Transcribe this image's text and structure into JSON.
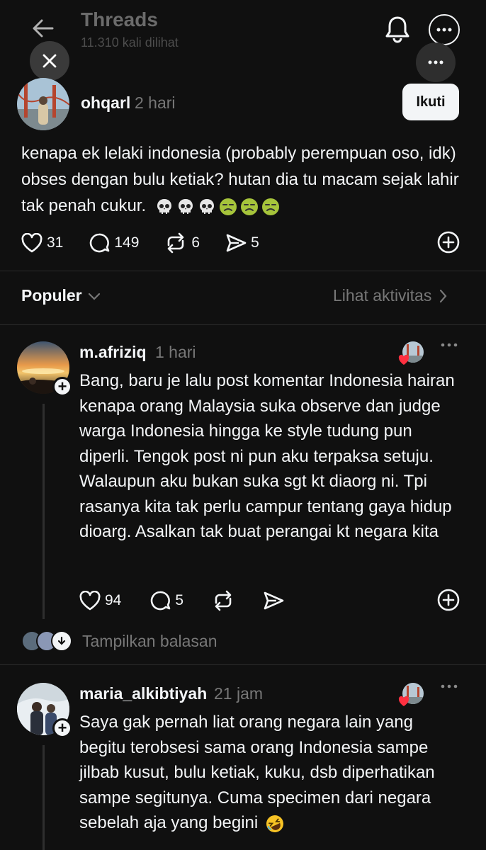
{
  "header": {
    "title": "Threads",
    "views": "11.310 kali dilihat"
  },
  "post": {
    "author": "ohqarl",
    "time": "2 hari",
    "follow_label": "Ikuti",
    "text": "kenapa ek lelaki indonesia (probably perempuan oso, idk) obses dengan bulu ketiak? hutan dia tu macam sejak lahir  tak penah cukur.",
    "emojis": [
      "skull",
      "skull",
      "skull",
      "nauseated-face",
      "nauseated-face",
      "nauseated-face"
    ],
    "likes": "31",
    "comments": "149",
    "reposts": "6",
    "shares": "5"
  },
  "sort": {
    "label": "Populer",
    "activity_label": "Lihat aktivitas"
  },
  "replies": [
    {
      "author": "m.afriziq",
      "time": "1 hari",
      "text": "Bang, baru je lalu post komentar Indonesia hairan kenapa orang Malaysia suka observe dan judge warga Indonesia hingga ke style tudung pun diperli. Tengok post ni pun aku terpaksa setuju. Walaupun aku bukan suka sgt kt diaorg ni. Tpi rasanya kita tak perlu campur tentang gaya hidup dioarg. Asalkan tak buat perangai kt negara kita",
      "likes": "94",
      "comments": "5",
      "show_replies_label": "Tampilkan balasan"
    },
    {
      "author": "maria_alkibtiyah",
      "time": "21 jam",
      "text": "Saya gak pernah liat orang negara lain yang begitu terobsesi sama orang Indonesia sampe jilbab kusut, bulu ketiak, kuku, dsb diperhatikan sampe segitunya. Cuma specimen dari negara sebelah aja yang begini",
      "emoji": "rolling-on-floor-laughing"
    }
  ],
  "colors": {
    "background": "#101010",
    "text": "#f3f5f7",
    "muted": "#777777",
    "liked": "#ff3040"
  }
}
